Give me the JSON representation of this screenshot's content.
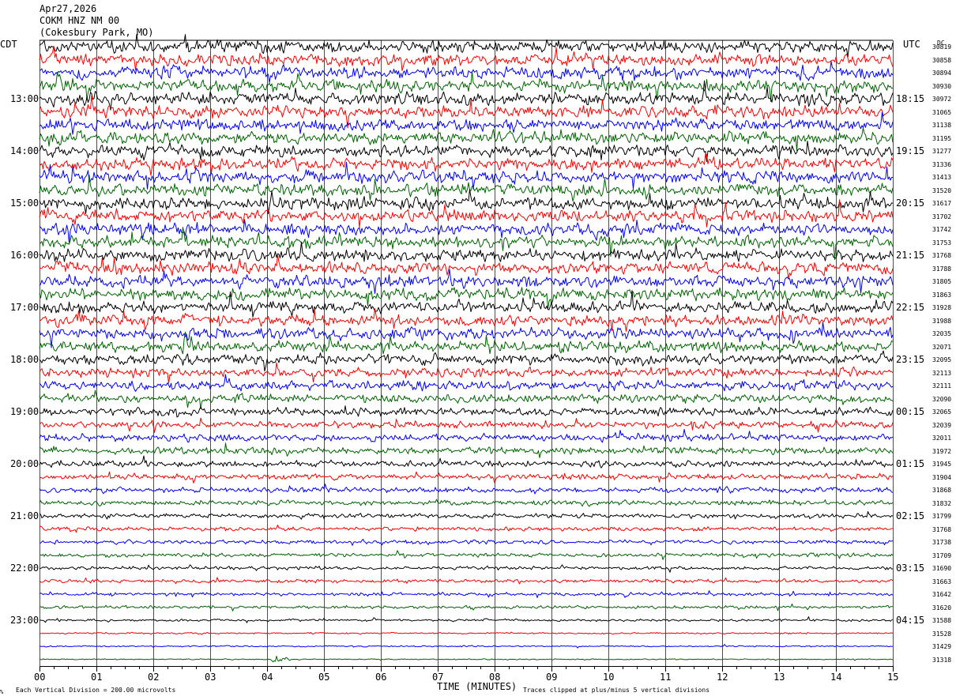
{
  "header": {
    "date": "Apr27,2026",
    "station": "COKM HNZ NM 00",
    "location": "(Cokesbury Park, MO)"
  },
  "axis_titles": {
    "left": "CDT",
    "right": "UTC",
    "dc": "DC"
  },
  "footer": {
    "scale_note": "Each Vertical Division =  200.00 microvolts",
    "xlabel": "TIME (MINUTES)",
    "clip_note": "Traces clipped at plus/minus 5 vertical divisions",
    "corner_mark": "%"
  },
  "colors": {
    "trace_cycle": [
      "#000000",
      "#ff0000",
      "#0000ff",
      "#006400"
    ],
    "grid": "#000000"
  },
  "chart_data": {
    "type": "line",
    "title": "",
    "xlabel": "TIME (MINUTES)",
    "xlim": [
      0,
      15
    ],
    "x_ticks": [
      "00",
      "01",
      "02",
      "03",
      "04",
      "05",
      "06",
      "07",
      "08",
      "09",
      "10",
      "11",
      "12",
      "13",
      "14",
      "15"
    ],
    "rows": 48,
    "rows_per_hour": 4,
    "left_hour_labels": [
      "13:00",
      "14:00",
      "15:00",
      "16:00",
      "17:00",
      "18:00",
      "19:00",
      "20:00",
      "21:00",
      "22:00",
      "23:00"
    ],
    "right_hour_labels": [
      "18:15",
      "19:15",
      "20:15",
      "21:15",
      "22:15",
      "23:15",
      "00:15",
      "01:15",
      "02:15",
      "03:15",
      "04:15"
    ],
    "dc_offsets": [
      "30819",
      "30858",
      "30894",
      "30930",
      "30972",
      "31065",
      "31138",
      "31195",
      "31277",
      "31336",
      "31413",
      "31520",
      "31617",
      "31702",
      "31742",
      "31753",
      "31768",
      "31788",
      "31805",
      "31863",
      "31928",
      "31988",
      "32035",
      "32071",
      "32095",
      "32113",
      "32111",
      "32090",
      "32065",
      "32039",
      "32011",
      "31972",
      "31945",
      "31904",
      "31868",
      "31832",
      "31799",
      "31768",
      "31738",
      "31709",
      "31690",
      "31663",
      "31642",
      "31620",
      "31588",
      "31528",
      "31429",
      "31318"
    ],
    "trace_amplitude_divisions": [
      6,
      6,
      6,
      6,
      6,
      6,
      6,
      6,
      6,
      6,
      6,
      6,
      6,
      6,
      6,
      6,
      6,
      6,
      6,
      6,
      5.5,
      5.5,
      5.5,
      5.5,
      5,
      4.5,
      4.5,
      4,
      4,
      3.5,
      3.5,
      3.5,
      3,
      2.8,
      2.6,
      2.4,
      2.2,
      2,
      1.9,
      1.8,
      1.7,
      1.7,
      1.6,
      1.5,
      1.2,
      0.8,
      0.7,
      0.5
    ],
    "clip_divisions": 5,
    "events": [
      {
        "row": 47,
        "minute": 4.1,
        "label": ""
      }
    ]
  }
}
